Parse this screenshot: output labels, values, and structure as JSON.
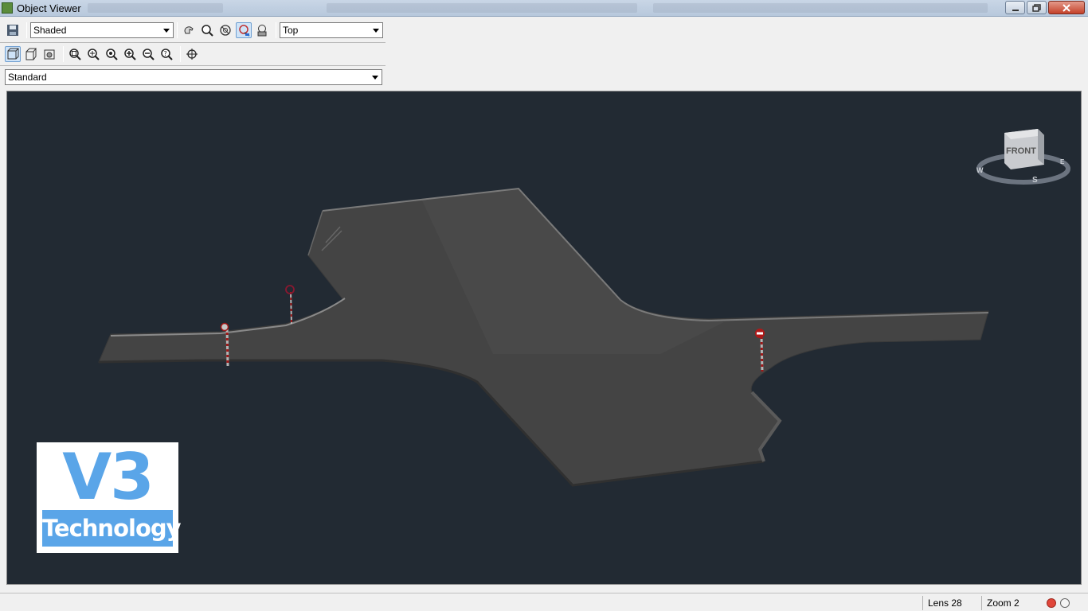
{
  "window": {
    "title": "Object Viewer"
  },
  "toolbar": {
    "visual_style": "Shaded",
    "view_direction": "Top",
    "view_style": "Standard"
  },
  "viewcube": {
    "face_label": "FRONT",
    "compass": {
      "west": "W",
      "south": "S",
      "east": "E"
    }
  },
  "logo": {
    "top_text": "V3",
    "bottom_text": "Technology",
    "color": "#5aa5e8"
  },
  "status": {
    "lens": "Lens 28",
    "zoom": "Zoom 2"
  },
  "colors": {
    "viewport_bg": "#222a33",
    "road": "#454545",
    "sign_red": "#b01818"
  }
}
